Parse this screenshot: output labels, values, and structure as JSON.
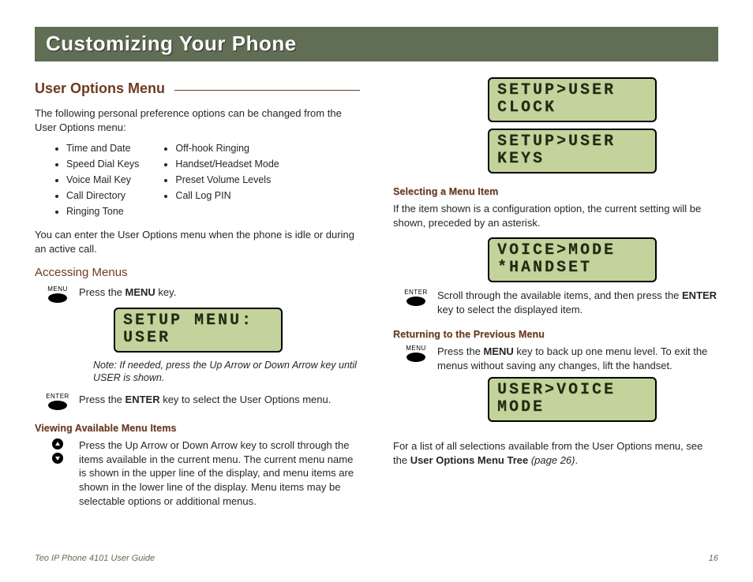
{
  "chapter_title": "Customizing Your Phone",
  "left": {
    "h2": "User Options Menu",
    "intro": "The following personal preference options can be changed from the User Options menu:",
    "list_col1": [
      "Time and Date",
      "Speed Dial Keys",
      "Voice Mail Key",
      "Call Directory",
      "Ringing Tone"
    ],
    "list_col2": [
      "Off-hook Ringing",
      "Handset/Headset Mode",
      "Preset Volume Levels",
      "Call Log PIN"
    ],
    "intro2": "You can enter the User Options menu when the phone is idle or during an active call.",
    "h3": "Accessing Menus",
    "step1_pre": "Press the ",
    "step1_bold": "MENU",
    "step1_post": " key.",
    "lcd1_l1": "SETUP MENU:",
    "lcd1_l2": "USER",
    "note": "Note:  If needed, press the Up Arrow or Down Arrow key until USER is shown.",
    "step2_pre": "Press the ",
    "step2_bold": "ENTER",
    "step2_post": " key to select the User Options menu.",
    "h4": "Viewing Available Menu Items",
    "view_body": "Press the Up Arrow or Down Arrow key to scroll through the items available in the current menu. The current menu name is shown in the upper line of the display, and menu items are shown in the lower line of the display. Menu items may be selectable options or additional menus.",
    "menu_label": "MENU",
    "enter_label": "ENTER"
  },
  "right": {
    "lcd_a_l1": "SETUP>USER",
    "lcd_a_l2": "CLOCK",
    "lcd_b_l1": "SETUP>USER",
    "lcd_b_l2": "KEYS",
    "h4a": "Selecting a Menu Item",
    "sel_body": "If the item shown is a configuration option, the current setting will be shown, preceded by an asterisk.",
    "lcd_c_l1": "VOICE>MODE",
    "lcd_c_l2": "*HANDSET",
    "sel_step_pre": "Scroll through the available items, and then press the ",
    "sel_step_bold": "ENTER",
    "sel_step_post": " key to select the displayed item.",
    "h4b": "Returning to the Previous Menu",
    "ret_pre": "Press the ",
    "ret_bold": "MENU",
    "ret_post": " key to back up one menu level. To exit the menus without saving any changes, lift the handset.",
    "lcd_d_l1": "USER>VOICE",
    "lcd_d_l2": "MODE",
    "closing_pre": "For a list of all selections available from the User Options menu, see the ",
    "closing_bold": "User Options Menu Tree",
    "closing_ref": " (page 26)",
    "closing_end": "."
  },
  "footer": {
    "left": "Teo IP Phone 4101 User Guide",
    "right": "16"
  }
}
